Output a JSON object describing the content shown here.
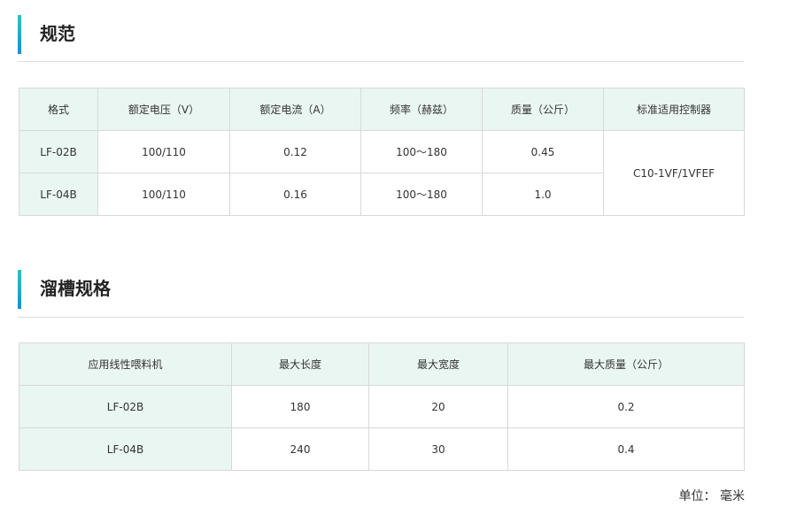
{
  "spec": {
    "title": "规范",
    "headers": [
      "格式",
      "额定电压（V）",
      "额定电流（A）",
      "频率（赫兹）",
      "质量（公斤）",
      "标准适用控制器"
    ],
    "rows": [
      [
        "LF-02B",
        "100/110",
        "0.12",
        "100～180",
        "0.45"
      ],
      [
        "LF-04B",
        "100/110",
        "0.16",
        "100～180",
        "1.0"
      ]
    ],
    "controller": "C10-1VF/1VFEF"
  },
  "groove": {
    "title": "溜槽规格",
    "headers": [
      "应用线性喂料机",
      "最大长度",
      "最大宽度",
      "最大质量（公斤）"
    ],
    "rows": [
      [
        "LF-02B",
        "180",
        "20",
        "0.2"
      ],
      [
        "LF-04B",
        "240",
        "30",
        "0.4"
      ]
    ]
  },
  "unit": "单位： 毫米",
  "colors": {
    "accent_top": "#2ec4b6",
    "accent_bottom": "#1a8fd6",
    "header_bg": "#eaf6f1",
    "border": "#d8d8d8"
  }
}
